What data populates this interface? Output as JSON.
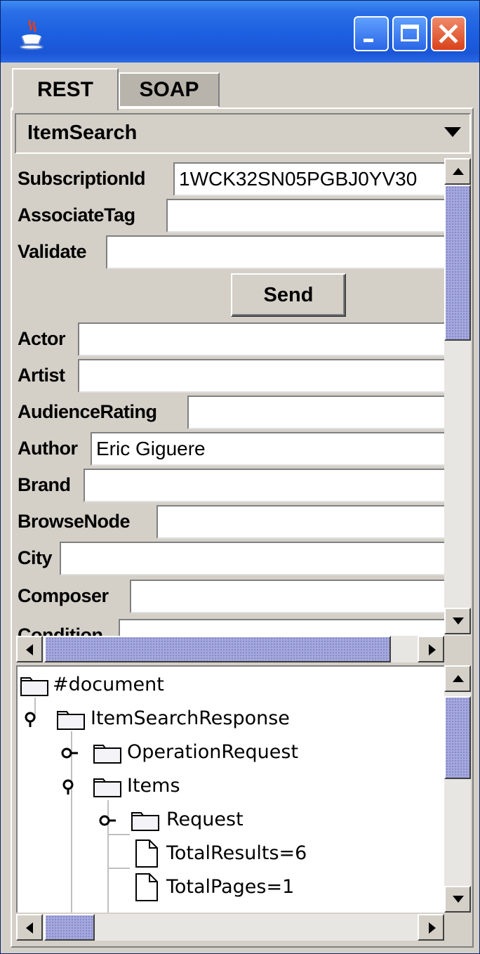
{
  "window": {
    "title": "",
    "icon": "java-coffee-icon",
    "controls": [
      "minimize-icon",
      "maximize-icon",
      "close-icon"
    ]
  },
  "tabs": [
    {
      "label": "REST",
      "selected": true
    },
    {
      "label": "SOAP",
      "selected": false
    }
  ],
  "operation": {
    "selected": "ItemSearch"
  },
  "form": {
    "fields_top": [
      {
        "label": "SubscriptionId",
        "value": "1WCK32SN05PGBJ0YV30"
      },
      {
        "label": "AssociateTag",
        "value": ""
      },
      {
        "label": "Validate",
        "value": ""
      }
    ],
    "send_label": "Send",
    "fields": [
      {
        "label": "Actor",
        "value": ""
      },
      {
        "label": "Artist",
        "value": ""
      },
      {
        "label": "AudienceRating",
        "value": ""
      },
      {
        "label": "Author",
        "value": "Eric Giguere"
      },
      {
        "label": "Brand",
        "value": ""
      },
      {
        "label": "BrowseNode",
        "value": ""
      },
      {
        "label": "City",
        "value": ""
      },
      {
        "label": "Composer",
        "value": ""
      },
      {
        "label": "Condition",
        "value": ""
      }
    ]
  },
  "tree": {
    "nodes": [
      {
        "label": "#document",
        "type": "folder"
      },
      {
        "label": "ItemSearchResponse",
        "type": "folder",
        "expanded": true
      },
      {
        "label": "OperationRequest",
        "type": "folder",
        "expanded": false
      },
      {
        "label": "Items",
        "type": "folder",
        "expanded": true
      },
      {
        "label": "Request",
        "type": "folder",
        "expanded": false
      },
      {
        "label": "TotalResults=6",
        "type": "leaf"
      },
      {
        "label": "TotalPages=1",
        "type": "leaf"
      }
    ]
  },
  "colors": {
    "titlebar": "#1c5fe0",
    "panel": "#d4d0c8",
    "scroll_thumb": "#a4a8dc",
    "close_button": "#d9421a"
  }
}
